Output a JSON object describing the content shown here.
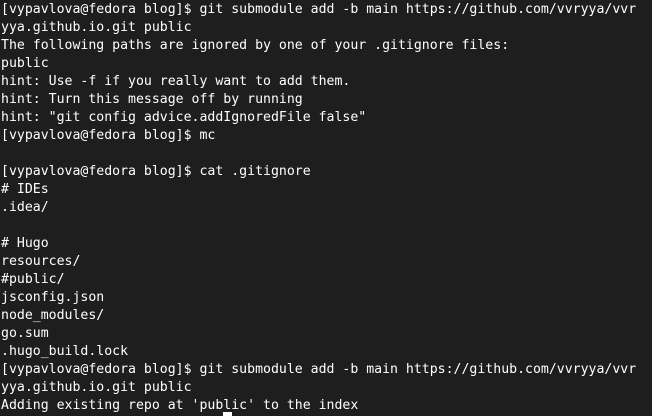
{
  "terminal": {
    "lines": [
      "[vypavlova@fedora blog]$ git submodule add -b main https://github.com/vvryya/vvr",
      "yya.github.io.git public",
      "The following paths are ignored by one of your .gitignore files:",
      "public",
      "hint: Use -f if you really want to add them.",
      "hint: Turn this message off by running",
      "hint: \"git config advice.addIgnoredFile false\"",
      "[vypavlova@fedora blog]$ mc",
      "",
      "[vypavlova@fedora blog]$ cat .gitignore",
      "# IDEs",
      ".idea/",
      "",
      "# Hugo",
      "resources/",
      "#public/",
      "jsconfig.json",
      "node_modules/",
      "go.sum",
      ".hugo_build.lock",
      "[vypavlova@fedora blog]$ git submodule add -b main https://github.com/vvryya/vvr",
      "yya.github.io.git public",
      "Adding existing repo at 'public' to the index"
    ]
  }
}
